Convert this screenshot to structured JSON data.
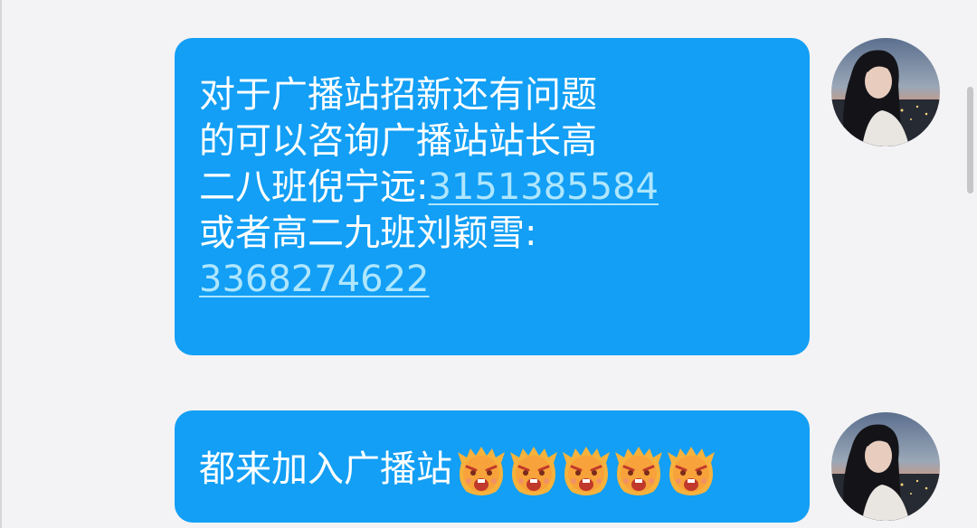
{
  "messages": [
    {
      "lines": [
        "对于广播站招新还有问题",
        "的可以咨询广播站站长高"
      ],
      "line3_prefix": "二八班倪宁远:",
      "phone1": "3151385584",
      "line4": "或者高二九班刘颖雪:",
      "phone2": "3368274622"
    },
    {
      "text": "都来加入广播站",
      "emoji_icon": "angry-face-icon",
      "emoji_count": 5
    }
  ],
  "colors": {
    "bubble": "#129ff5",
    "link": "#aee6ff",
    "background": "#f3f3f5"
  }
}
